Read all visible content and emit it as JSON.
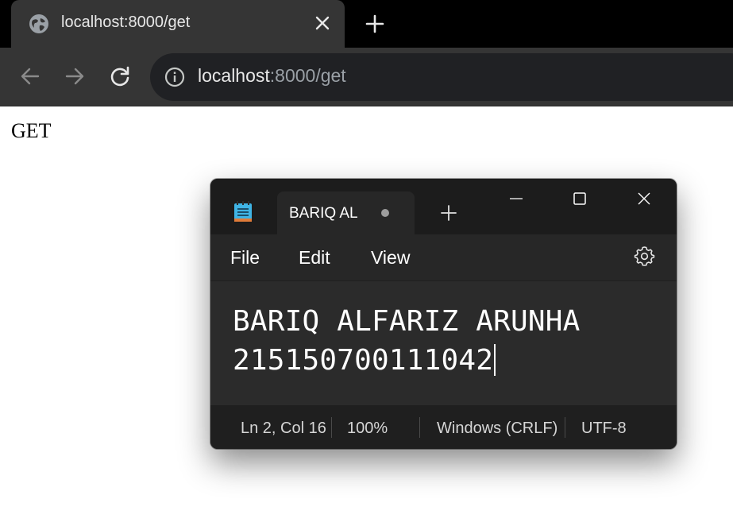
{
  "browser": {
    "tab": {
      "title": "localhost:8000/get",
      "favicon": "globe-icon",
      "close_icon": "close-icon"
    },
    "new_tab_icon": "plus-icon",
    "nav": {
      "back_icon": "arrow-left-icon",
      "forward_icon": "arrow-right-icon",
      "reload_icon": "reload-icon"
    },
    "address_bar": {
      "info_icon": "info-icon",
      "host": "localhost",
      "path": ":8000/get"
    },
    "colors": {
      "tabstrip": "#000000",
      "toolbar": "#353535",
      "omnibox": "#202124"
    }
  },
  "page": {
    "body_text": "GET"
  },
  "notepad": {
    "app_icon": "notepad-icon",
    "tab": {
      "title": "BARIQ AL",
      "unsaved_indicator": "dot-icon"
    },
    "new_tab_icon": "plus-icon",
    "window_controls": [
      "minimize-icon",
      "maximize-icon",
      "close-icon"
    ],
    "menu": {
      "file": "File",
      "edit": "Edit",
      "view": "View",
      "settings_icon": "gear-icon"
    },
    "editor": {
      "lines": [
        "BARIQ ALFARIZ ARUNHA",
        "215150700111042"
      ]
    },
    "status": {
      "position": "Ln 2, Col 16",
      "zoom": "100%",
      "line_ending": "Windows (CRLF)",
      "encoding": "UTF-8"
    },
    "colors": {
      "titlebar": "#1c1c1c",
      "editor": "#2b2b2b",
      "statusbar": "#1f1f1f"
    }
  }
}
